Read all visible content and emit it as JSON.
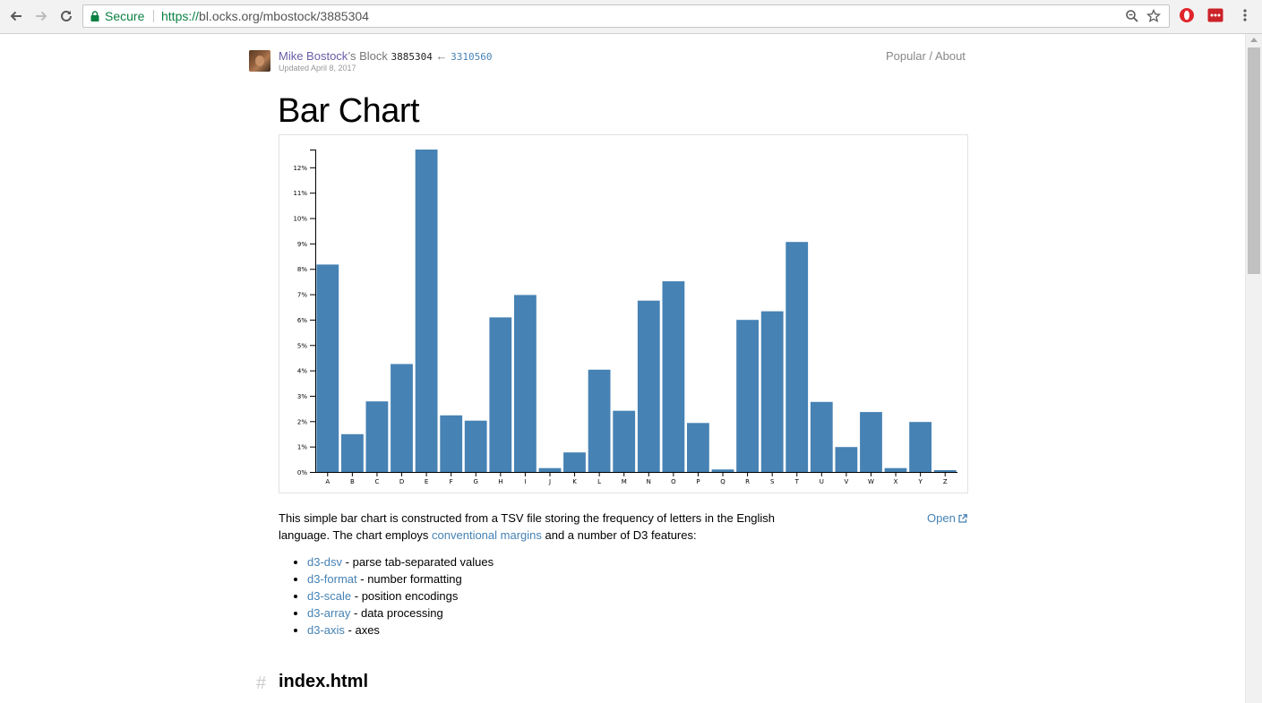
{
  "browser": {
    "secure_label": "Secure",
    "url_scheme": "https://",
    "url_host": "bl.ocks.org",
    "url_path": "/mbostock/3885304"
  },
  "header": {
    "author": "Mike Bostock",
    "author_suffix": "’s Block",
    "block_id": "3885304",
    "arrow": "←",
    "parent_id": "3310560",
    "updated": "Updated April 8, 2017",
    "nav_popular": "Popular",
    "nav_sep": " / ",
    "nav_about": "About"
  },
  "page": {
    "title": "Bar Chart",
    "desc_part1": "This simple bar chart is constructed from a TSV file storing the frequency of letters in the English language. The chart employs ",
    "desc_link": "conventional margins",
    "desc_part2": " and a number of D3 features:",
    "open_label": "Open",
    "libs": [
      {
        "name": "d3-dsv",
        "text": " - parse tab-separated values"
      },
      {
        "name": "d3-format",
        "text": " - number formatting"
      },
      {
        "name": "d3-scale",
        "text": " - position encodings"
      },
      {
        "name": "d3-array",
        "text": " - data processing"
      },
      {
        "name": "d3-axis",
        "text": " - axes"
      }
    ],
    "hash": "#",
    "file_title": "index.html"
  },
  "chart_data": {
    "type": "bar",
    "categories": [
      "A",
      "B",
      "C",
      "D",
      "E",
      "F",
      "G",
      "H",
      "I",
      "J",
      "K",
      "L",
      "M",
      "N",
      "O",
      "P",
      "Q",
      "R",
      "S",
      "T",
      "U",
      "V",
      "W",
      "X",
      "Y",
      "Z"
    ],
    "values": [
      8.17,
      1.49,
      2.78,
      4.25,
      12.7,
      2.23,
      2.02,
      6.09,
      6.97,
      0.15,
      0.77,
      4.03,
      2.41,
      6.75,
      7.51,
      1.93,
      0.1,
      5.99,
      6.33,
      9.06,
      2.76,
      0.98,
      2.36,
      0.15,
      1.97,
      0.07
    ],
    "yticks": [
      "0%",
      "1%",
      "2%",
      "3%",
      "4%",
      "5%",
      "6%",
      "7%",
      "8%",
      "9%",
      "10%",
      "11%",
      "12%"
    ],
    "ylim": [
      0,
      12.7
    ],
    "color": "#4682b4"
  }
}
